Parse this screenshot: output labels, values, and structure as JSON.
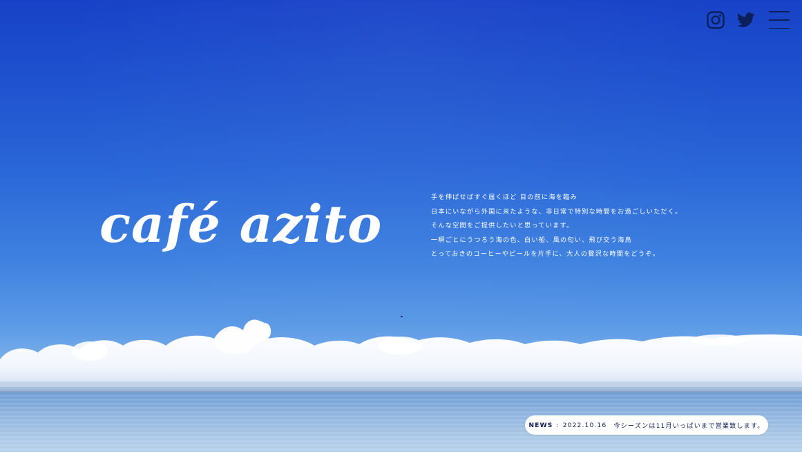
{
  "header": {
    "instagram_icon": "instagram-icon",
    "twitter_icon": "twitter-icon",
    "menu_icon": "hamburger-menu-icon",
    "icon_color": "#0c1f5a"
  },
  "hero": {
    "logo_text": "café azito",
    "intro_lines": [
      "手を伸ばせばすぐ届くほど 目の前に海を臨み",
      "日本にいながら外国に来たような、非日常で特別な時間をお過ごしいただく。",
      "そんな空間をご提供したいと思っています。",
      "一瞬ごとにうつろう海の色、白い船、風の匂い、飛び交う海鳥",
      "とっておきのコーヒーやビールを片手に、大人の贅沢な時間をどうぞ。"
    ]
  },
  "news": {
    "label": "NEWS",
    "separator": ":",
    "date": "2022.10.16",
    "text": "今シーズンは11月いっぱいまで営業致します。"
  },
  "colors": {
    "sky_top": "#1742c7",
    "sky_bottom": "#8fbde9",
    "text_dark": "#0d1f55",
    "pill_bg": "#ffffff"
  }
}
